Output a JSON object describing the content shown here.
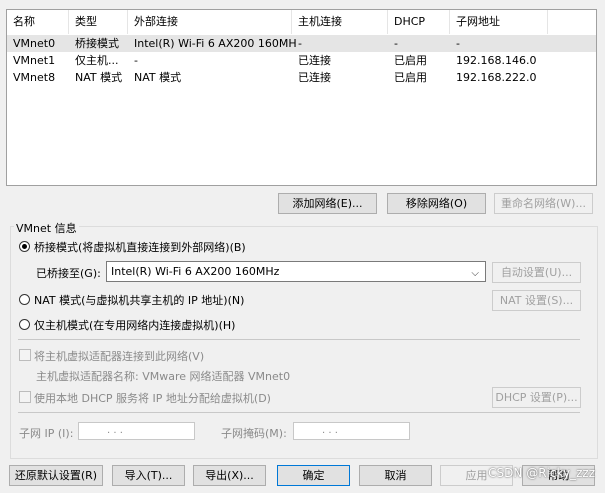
{
  "table": {
    "headers": [
      "名称",
      "类型",
      "外部连接",
      "主机连接",
      "DHCP",
      "子网地址"
    ],
    "rows": [
      {
        "name": "VMnet0",
        "type": "桥接模式",
        "external": "Intel(R) Wi-Fi 6 AX200 160MHz",
        "host": "-",
        "dhcp": "-",
        "subnet": "-"
      },
      {
        "name": "VMnet1",
        "type": "仅主机...",
        "external": "-",
        "host": "已连接",
        "dhcp": "已启用",
        "subnet": "192.168.146.0"
      },
      {
        "name": "VMnet8",
        "type": "NAT 模式",
        "external": "NAT 模式",
        "host": "已连接",
        "dhcp": "已启用",
        "subnet": "192.168.222.0"
      }
    ]
  },
  "table_buttons": {
    "add": "添加网络(E)...",
    "remove": "移除网络(O)",
    "rename": "重命名网络(W)..."
  },
  "vmnet_info": {
    "legend": "VMnet 信息",
    "bridge_label": "桥接模式(将虚拟机直接连接到外部网络)(B)",
    "bridged_to_label": "已桥接至(G):",
    "bridged_to_value": "Intel(R) Wi-Fi 6 AX200 160MHz",
    "auto_settings": "自动设置(U)...",
    "nat_label": "NAT 模式(与虚拟机共享主机的 IP 地址)(N)",
    "nat_settings": "NAT 设置(S)...",
    "hostonly_label": "仅主机模式(在专用网络内连接虚拟机)(H)",
    "connect_adapter_label": "将主机虚拟适配器连接到此网络(V)",
    "adapter_name_label": "主机虚拟适配器名称: VMware 网络适配器 VMnet0",
    "use_dhcp_label": "使用本地 DHCP 服务将 IP 地址分配给虚拟机(D)",
    "dhcp_settings": "DHCP 设置(P)...",
    "subnet_ip_label": "子网 IP (I):",
    "subnet_mask_label": "子网掩码(M):",
    "ip_dots": ".        .        .",
    "mask_dots": ".        .        ."
  },
  "bottom_buttons": {
    "restore": "还原默认设置(R)",
    "import": "导入(T)...",
    "export": "导出(X)...",
    "ok": "确定",
    "cancel": "取消",
    "apply": "应用",
    "help": "帮助"
  },
  "watermark": "CSDN @Ricky_zzz"
}
